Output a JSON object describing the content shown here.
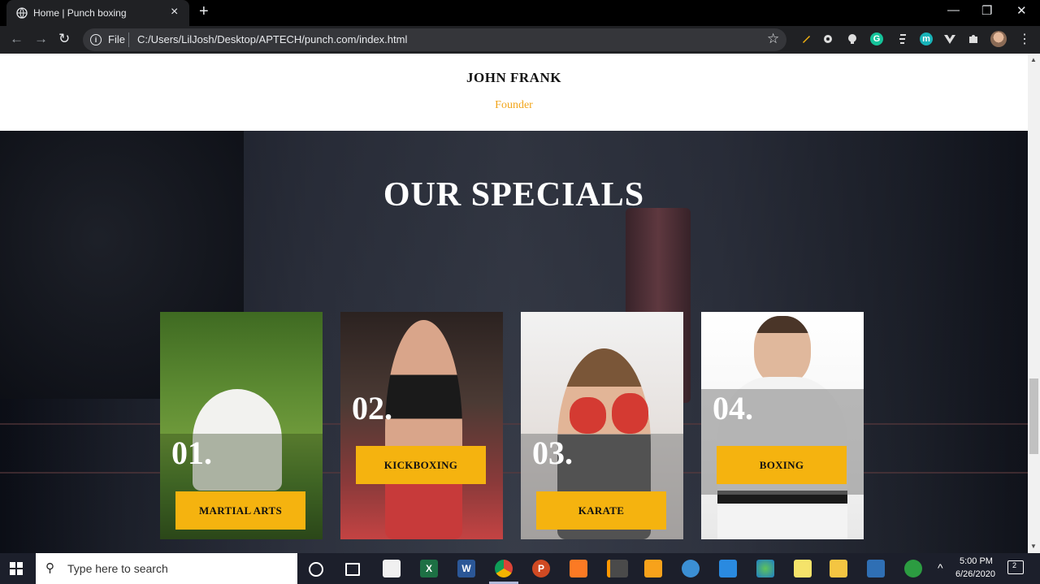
{
  "browser": {
    "tab_title": "Home | Punch boxing",
    "new_tab": "+",
    "tab_close": "×",
    "window": {
      "minimize": "—",
      "restore": "❐",
      "close": "✕"
    },
    "nav": {
      "back": "←",
      "forward": "→",
      "reload": "↻"
    },
    "address": {
      "info": "i",
      "scheme_label": "File",
      "url": "C:/Users/LilJosh/Desktop/APTECH/punch.com/index.html"
    },
    "bookmark_star": "☆",
    "extensions": [
      "pencil-icon",
      "gear-icon",
      "bulb-icon",
      "grammarly-icon",
      "script-icon",
      "m-extension-icon",
      "vue-icon",
      "puzzle-icon"
    ],
    "grammarly_letter": "G",
    "m_letter": "m",
    "menu": "⋮"
  },
  "page": {
    "founder": {
      "name": "JOHN FRANK",
      "role": "Founder"
    },
    "specials": {
      "title": "OUR SPECIALS",
      "cards": [
        {
          "number": "01.",
          "label": "MARTIAL ARTS"
        },
        {
          "number": "02.",
          "label": "KICKBOXING"
        },
        {
          "number": "03.",
          "label": "KARATE"
        },
        {
          "number": "04.",
          "label": "BOXING"
        }
      ]
    }
  },
  "taskbar": {
    "search_placeholder": "Type here to search",
    "time": "5:00 PM",
    "date": "6/26/2020",
    "tray_arrow": "^",
    "notification_count": "2",
    "apps": [
      "cortana-icon",
      "task-view-icon",
      "store-icon",
      "excel-icon",
      "word-icon",
      "chrome-icon",
      "powerpoint-icon",
      "xampp-icon",
      "sublime-icon",
      "winrar-icon",
      "corel-icon",
      "vscode-icon",
      "globe-icon",
      "notepad-icon",
      "file-explorer-icon",
      "photos-icon",
      "upwork-icon"
    ],
    "excel_letter": "X",
    "word_letter": "W",
    "powerpoint_letter": "P"
  }
}
